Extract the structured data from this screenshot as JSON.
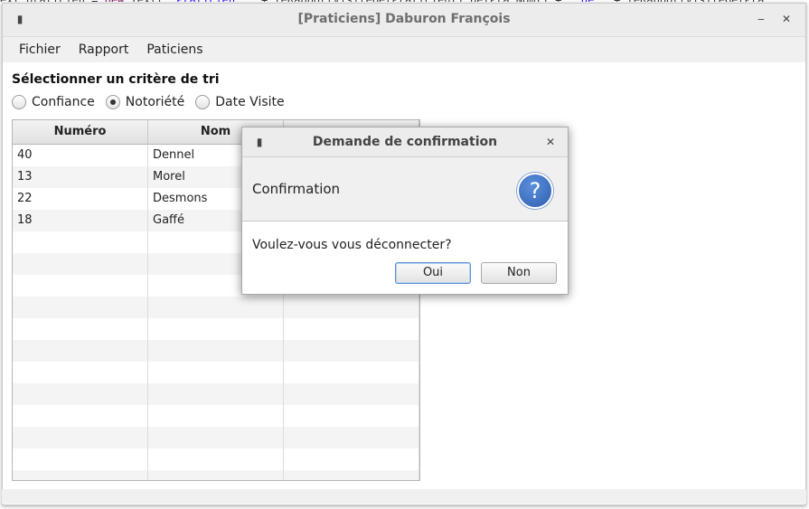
{
  "background": {
    "code_fragments": [
      {
        "text": "ext praticien = ",
        "cls": ""
      },
      {
        "text": "new",
        "cls": "kw"
      },
      {
        "text": " Text( ",
        "cls": ""
      },
      {
        "text": "\"Praticien: \"",
        "cls": "str"
      },
      {
        "text": " + leRapportVisiteGetPraticien().getPra_Nom() + ",
        "cls": ""
      },
      {
        "text": "\" de \"",
        "cls": "str"
      },
      {
        "text": " + leRapportVisiteGetPra",
        "cls": ""
      }
    ]
  },
  "window": {
    "title": "[Praticiens] Daburon François",
    "menu_icon": "▮",
    "minimize_icon": "‒",
    "close_icon": "✕"
  },
  "menubar": {
    "items": [
      "Fichier",
      "Rapport",
      "Paticiens"
    ]
  },
  "sort": {
    "title": "Sélectionner un critère de tri",
    "options": [
      {
        "label": "Confiance",
        "checked": false
      },
      {
        "label": "Notoriété",
        "checked": true
      },
      {
        "label": "Date Visite",
        "checked": false
      }
    ]
  },
  "table": {
    "columns": [
      "Numéro",
      "Nom",
      ""
    ],
    "rows": [
      [
        "40",
        "Dennel",
        ""
      ],
      [
        "13",
        "Morel",
        ""
      ],
      [
        "22",
        "Desmons",
        ""
      ],
      [
        "18",
        "Gaffé",
        ""
      ]
    ],
    "empty_rows": 12
  },
  "dialog": {
    "title": "Demande de confirmation",
    "menu_icon": "▮",
    "close_icon": "✕",
    "header": "Confirmation",
    "icon_glyph": "?",
    "message": "Voulez-vous vous déconnecter?",
    "ok_label": "Oui",
    "cancel_label": "Non"
  },
  "colors": {
    "accent": "#2e5fae",
    "default_button_border": "#5b8fd6"
  }
}
